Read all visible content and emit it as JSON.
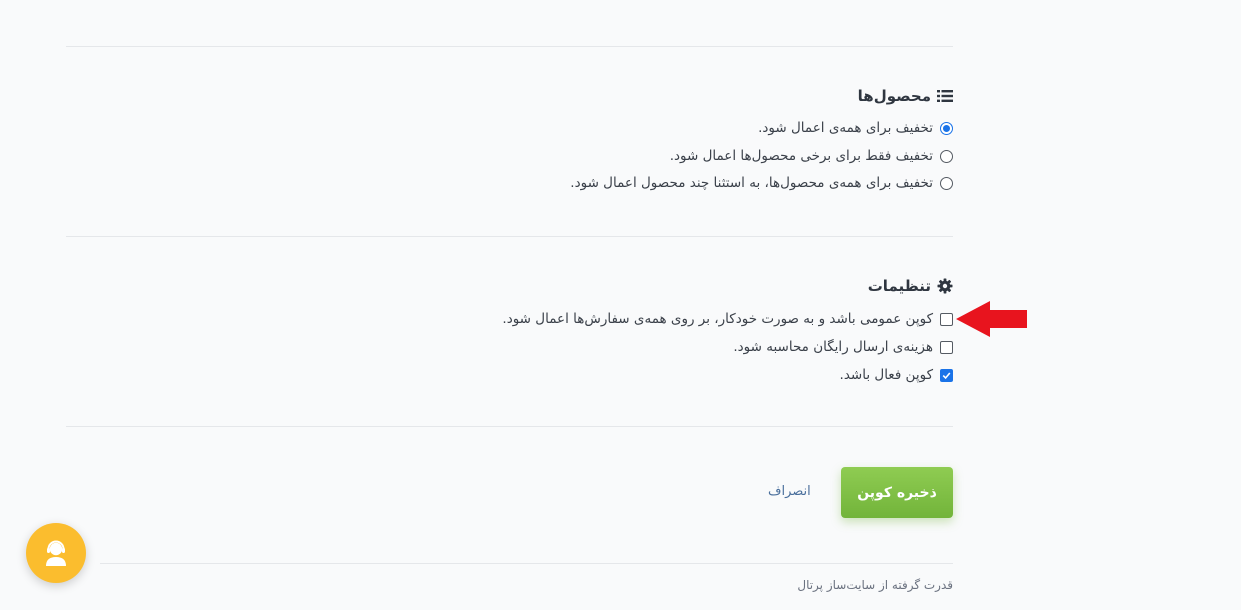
{
  "products": {
    "title": "محصول‌ها",
    "icon": "list-icon",
    "options": [
      {
        "label": "تخفیف برای همه‌ی اعمال شود.",
        "checked": true
      },
      {
        "label": "تخفیف فقط برای برخی محصول‌ها اعمال شود.",
        "checked": false
      },
      {
        "label": "تخفیف برای همه‌ی محصول‌ها، به استثنا چند محصول اعمال شود.",
        "checked": false
      }
    ]
  },
  "settings": {
    "title": "تنظیمات",
    "icon": "gear-icon",
    "options": [
      {
        "label": "کوپن عمومی باشد و به صورت خودکار، بر روی همه‌ی سفارش‌ها اعمال شود.",
        "checked": false
      },
      {
        "label": "هزینه‌ی ارسال رایگان محاسبه شود.",
        "checked": false
      },
      {
        "label": "کوپن فعال باشد.",
        "checked": true
      }
    ]
  },
  "actions": {
    "save_label": "ذخیره کوپن",
    "cancel_label": "انصراف"
  },
  "footer": {
    "powered_by": "قدرت گرفته از سایت‌ساز پرتال"
  },
  "colors": {
    "accent": "#1a73e8",
    "save_button": "#7cbf42",
    "support_button": "#fbbd2e",
    "annotation_arrow": "#e8141e"
  }
}
